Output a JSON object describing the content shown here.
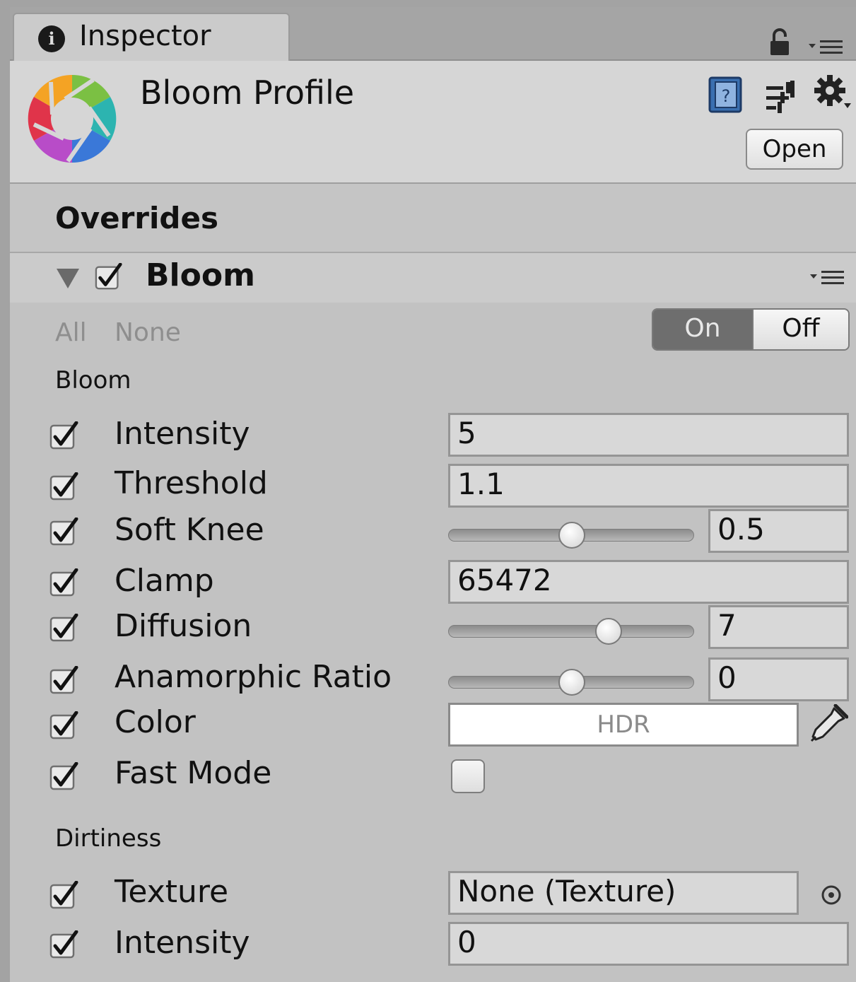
{
  "tab": {
    "title": "Inspector"
  },
  "header": {
    "title": "Bloom Profile",
    "open_label": "Open"
  },
  "overrides": {
    "title": "Overrides"
  },
  "component": {
    "title": "Bloom",
    "enabled": true,
    "all_label": "All",
    "none_label": "None",
    "toggle": {
      "on": "On",
      "off": "Off",
      "selected": "On"
    }
  },
  "bloom_section": {
    "label": "Bloom",
    "intensity": {
      "label": "Intensity",
      "value": "5"
    },
    "threshold": {
      "label": "Threshold",
      "value": "1.1"
    },
    "soft_knee": {
      "label": "Soft Knee",
      "value": "0.5",
      "slider_fraction": 0.5
    },
    "clamp": {
      "label": "Clamp",
      "value": "65472"
    },
    "diffusion": {
      "label": "Diffusion",
      "value": "7",
      "slider_fraction": 0.65
    },
    "anamorphic_ratio": {
      "label": "Anamorphic Ratio",
      "value": "0",
      "slider_fraction": 0.5
    },
    "color": {
      "label": "Color",
      "value": "HDR"
    },
    "fast_mode": {
      "label": "Fast Mode",
      "checked": false
    }
  },
  "dirtiness_section": {
    "label": "Dirtiness",
    "texture": {
      "label": "Texture",
      "value": "None (Texture)"
    },
    "intensity": {
      "label": "Intensity",
      "value": "0"
    }
  },
  "colors": {
    "window_bg": "#c2c2c2",
    "header_bg": "#d6d6d6",
    "toggle_on_bg": "#6e6e6e"
  }
}
